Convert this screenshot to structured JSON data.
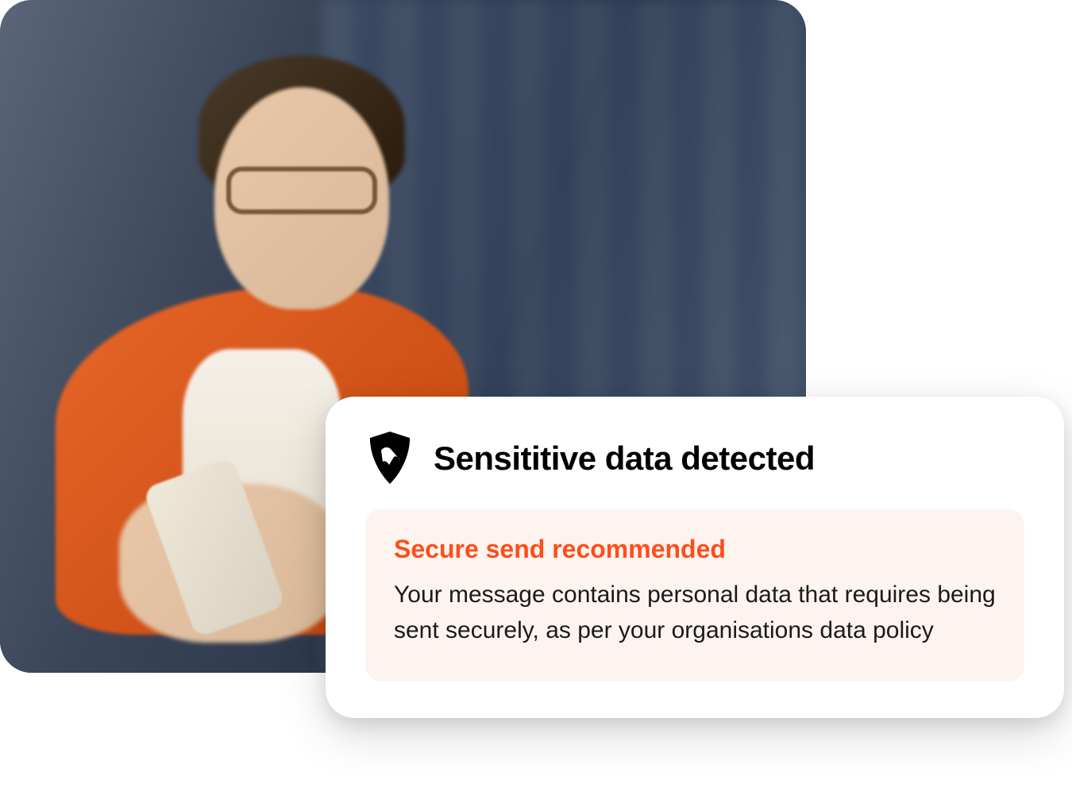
{
  "notification": {
    "title": "Sensititive data detected",
    "icon": "shield-bird-icon",
    "alert": {
      "heading": "Secure send recommended",
      "body": "Your message contains personal data that requires being sent securely, as per your organisations data policy"
    }
  },
  "colors": {
    "accent": "#ff4d1a",
    "alert_bg": "#fdf4f0",
    "card_bg": "#ffffff"
  }
}
